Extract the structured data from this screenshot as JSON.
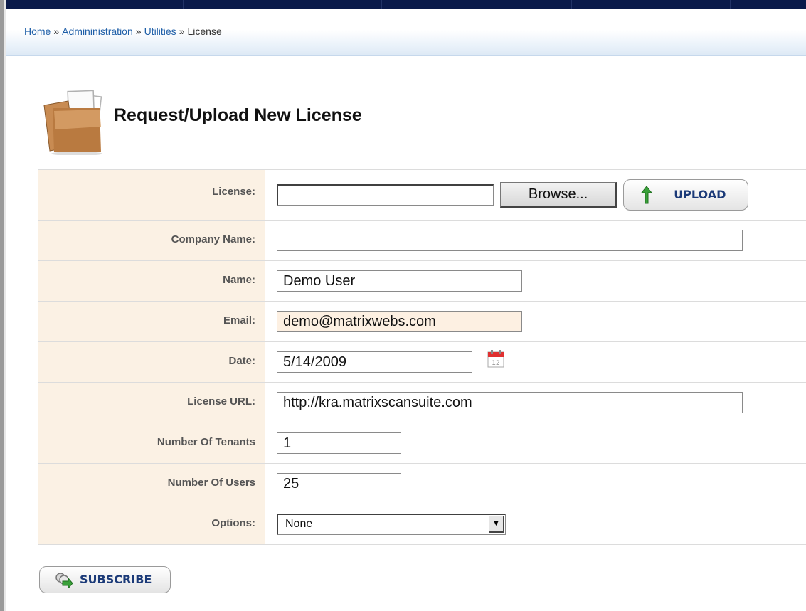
{
  "breadcrumb": {
    "items": [
      "Home",
      "Admininistration",
      "Utilities",
      "License"
    ],
    "separator": "»"
  },
  "page": {
    "title": "Request/Upload New License",
    "icon": "license-folder-icon"
  },
  "form": {
    "license": {
      "label": "License:",
      "value": "",
      "browse_label": "Browse...",
      "upload_label": "UPLOAD"
    },
    "company_name": {
      "label": "Company Name:",
      "value": ""
    },
    "name": {
      "label": "Name:",
      "value": "Demo User"
    },
    "email": {
      "label": "Email:",
      "value": "demo@matrixwebs.com"
    },
    "date": {
      "label": "Date:",
      "value": "5/14/2009",
      "icon": "calendar-icon"
    },
    "license_url": {
      "label": "License URL:",
      "value": "http://kra.matrixscansuite.com"
    },
    "tenants": {
      "label": "Number Of Tenants",
      "value": "1"
    },
    "users": {
      "label": "Number Of Users",
      "value": "25"
    },
    "options": {
      "label": "Options:",
      "selected": "None"
    }
  },
  "actions": {
    "subscribe_label": "SUBSCRIBE"
  },
  "colors": {
    "top_bar": "#0a1a4a",
    "label_bg": "#fbf1e4",
    "link": "#1f5fa8",
    "button_text": "#1b3a78",
    "highlight_input": "#fdf0e2"
  }
}
